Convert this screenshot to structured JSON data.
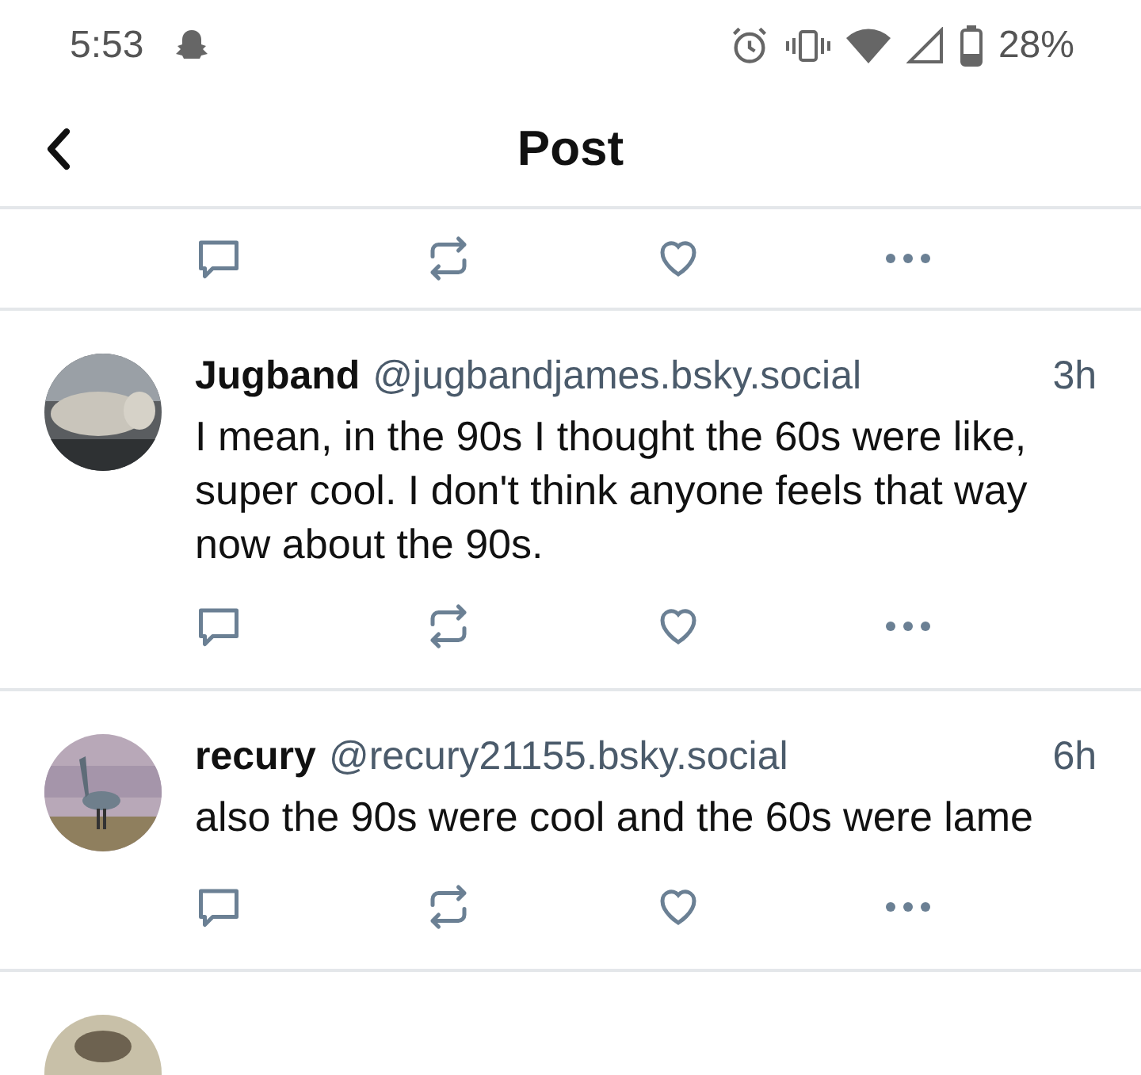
{
  "status_bar": {
    "time": "5:53",
    "battery": "28%"
  },
  "header": {
    "title": "Post"
  },
  "feed": [
    {
      "kind": "actions_only"
    },
    {
      "kind": "post",
      "name": "Jugband",
      "handle": "@jugbandjames.bsky.social",
      "time": "3h",
      "text": "I mean, in the 90s I thought the 60s were like, super cool. I don't think anyone feels that way now about the 90s."
    },
    {
      "kind": "post",
      "name": "recury",
      "handle": "@recury21155.bsky.social",
      "time": "6h",
      "text": "also the 90s were cool and the 60s were lame"
    },
    {
      "kind": "avatar_only"
    }
  ]
}
